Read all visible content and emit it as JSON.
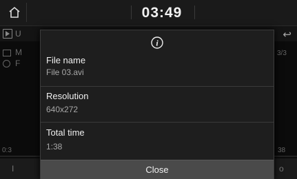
{
  "statusbar": {
    "time": "03:49",
    "home_icon": "home-icon"
  },
  "background": {
    "source_text": "U",
    "folder_text": "M",
    "file_text": "F",
    "track_count": "3/3",
    "elapsed": "0:3",
    "remaining": "38",
    "left_ctrl": "I",
    "right_ctrl": "o"
  },
  "popup": {
    "icon": "info-icon",
    "fields": [
      {
        "label": "File name",
        "value": "File 03.avi"
      },
      {
        "label": "Resolution",
        "value": "640x272"
      },
      {
        "label": "Total time",
        "value": "1:38"
      }
    ],
    "close_label": "Close"
  }
}
